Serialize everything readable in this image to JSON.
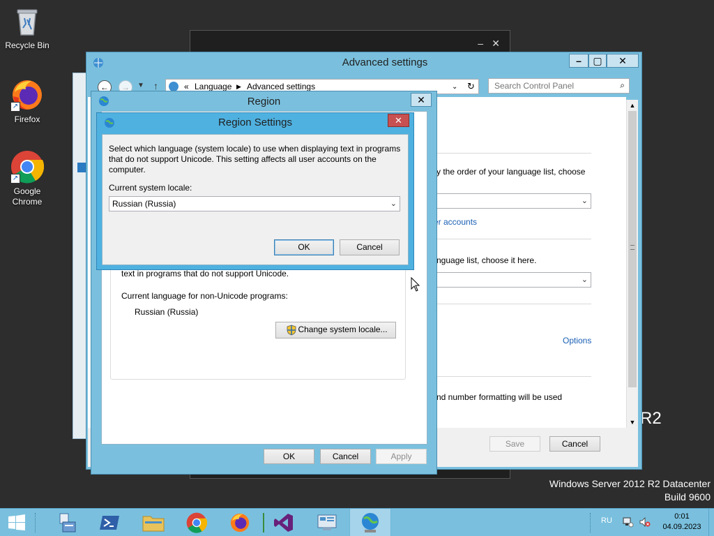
{
  "desktop": {
    "icons": [
      {
        "label": "Recycle Bin"
      },
      {
        "label": "Firefox"
      },
      {
        "label": "Google Chrome"
      }
    ],
    "watermark": {
      "line1": "Windows Server 2012 R2 Datacenter",
      "line2": "Build 9600",
      "r2": "R2"
    }
  },
  "advanced_window": {
    "title": "Advanced settings",
    "breadcrumb": {
      "prefix": "«",
      "items": [
        "Language",
        "Advanced settings"
      ]
    },
    "search_placeholder": "Search Control Panel",
    "partial_texts": {
      "order_text": "y the order of your language list, choose",
      "accounts_link": "er accounts",
      "language_list_text": "nguage list, choose it here.",
      "options_link": "Options",
      "formatting_text": "nd number formatting will be used"
    },
    "save_label": "Save",
    "cancel_label": "Cancel"
  },
  "region_window": {
    "title": "Region",
    "nonunicode_fragment": "text in programs that do not support Unicode.",
    "current_language_label": "Current language for non-Unicode programs:",
    "current_language_value": "Russian (Russia)",
    "change_locale_label": "Change system locale...",
    "ok_label": "OK",
    "cancel_label": "Cancel",
    "apply_label": "Apply"
  },
  "region_settings_dialog": {
    "title": "Region Settings",
    "description_line1": "Select which language (system locale) to use when displaying text in programs",
    "description_line2": "that do not support Unicode. This setting affects all user accounts on the",
    "description_line3": "computer.",
    "locale_label": "Current system locale:",
    "locale_value": "Russian (Russia)",
    "ok_label": "OK",
    "cancel_label": "Cancel"
  },
  "taskbar": {
    "language": "RU",
    "time": "0:01",
    "date": "04.09.2023"
  }
}
